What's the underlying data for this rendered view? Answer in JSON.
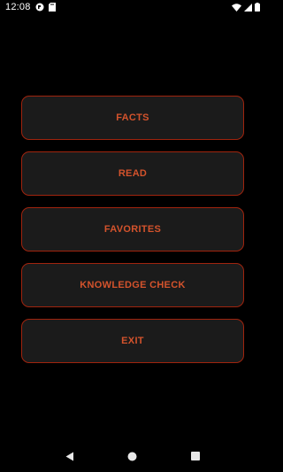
{
  "status_bar": {
    "time": "12:08",
    "icons_left": [
      "app-notification-icon",
      "sd-card-icon"
    ],
    "icons_right": [
      "wifi-icon",
      "signal-icon",
      "battery-icon"
    ]
  },
  "menu": {
    "items": [
      {
        "label": "FACTS"
      },
      {
        "label": "READ"
      },
      {
        "label": "FAVORITES"
      },
      {
        "label": "KNOWLEDGE CHECK"
      },
      {
        "label": "EXIT"
      }
    ]
  },
  "nav_bar": {
    "buttons": [
      "back-icon",
      "home-icon",
      "recents-icon"
    ]
  },
  "colors": {
    "background": "#000000",
    "button_fill": "#1b1b1b",
    "button_border": "#a0240e",
    "button_text": "#d4532c"
  }
}
